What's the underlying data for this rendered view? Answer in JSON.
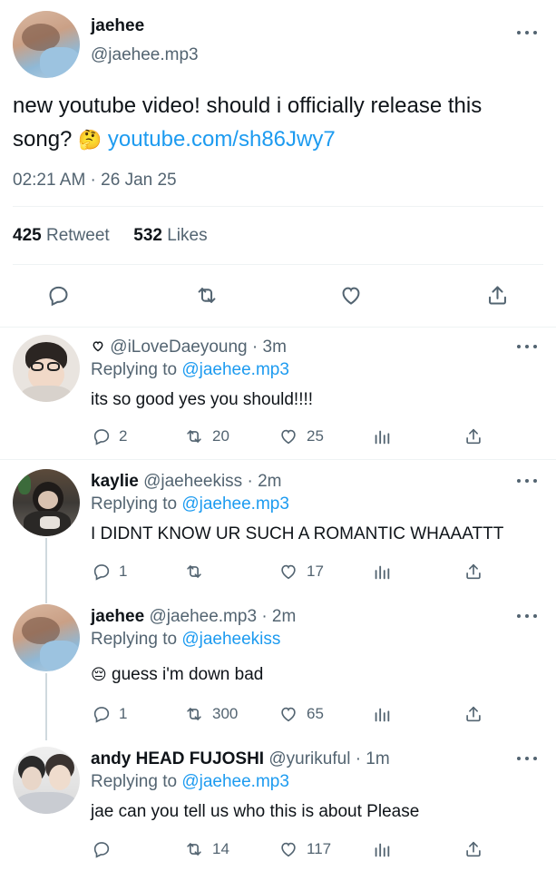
{
  "main_tweet": {
    "display_name": "jaehee",
    "handle": "@jaehee.mp3",
    "text_line1": "new youtube video! should i officially release this",
    "text_line2_prefix": "song?",
    "emoji": "🤔",
    "link": "youtube.com/sh86Jwy7",
    "timestamp": "02:21 AM · 26 Jan 25",
    "retweet_count": "425",
    "retweet_label": "Retweet",
    "likes_count": "532",
    "likes_label": "Likes"
  },
  "replies": [
    {
      "name": "",
      "handle": "@iLoveDaeyoung",
      "time": "· 3m",
      "replying_label": "Replying to",
      "replying_to": "@jaehee.mp3",
      "text": "its so good yes you should!!!!",
      "counts": {
        "reply": "2",
        "retweet": "20",
        "like": "25"
      }
    },
    {
      "name": "kaylie",
      "handle": "@jaeheekiss",
      "time": "· 2m",
      "replying_label": "Replying to",
      "replying_to": "@jaehee.mp3",
      "text": "I DIDNT KNOW UR SUCH A ROMANTIC WHAAATTT",
      "counts": {
        "reply": "1",
        "retweet": "",
        "like": "17"
      }
    },
    {
      "name": "jaehee",
      "handle": "@jaehee.mp3",
      "time": "· 2m",
      "replying_label": "Replying to",
      "replying_to": "@jaeheekiss",
      "emoji": "😔",
      "text": "guess i'm down bad",
      "counts": {
        "reply": "1",
        "retweet": "300",
        "like": "65"
      }
    },
    {
      "name": "andy HEAD FUJOSHI",
      "handle": "@yurikuful",
      "time": "· 1m",
      "replying_label": "Replying to",
      "replying_to": "@jaehee.mp3",
      "text": "jae can you tell us who this is about Please",
      "counts": {
        "reply": "",
        "retweet": "14",
        "like": "117"
      }
    }
  ],
  "icons": [
    "more-icon",
    "reply-icon",
    "retweet-icon",
    "like-icon",
    "share-icon",
    "views-icon",
    "heart-outline-icon"
  ],
  "colors": {
    "text": "#0f1419",
    "muted": "#536471",
    "link": "#1d9bf0",
    "divider": "#eff3f4"
  }
}
